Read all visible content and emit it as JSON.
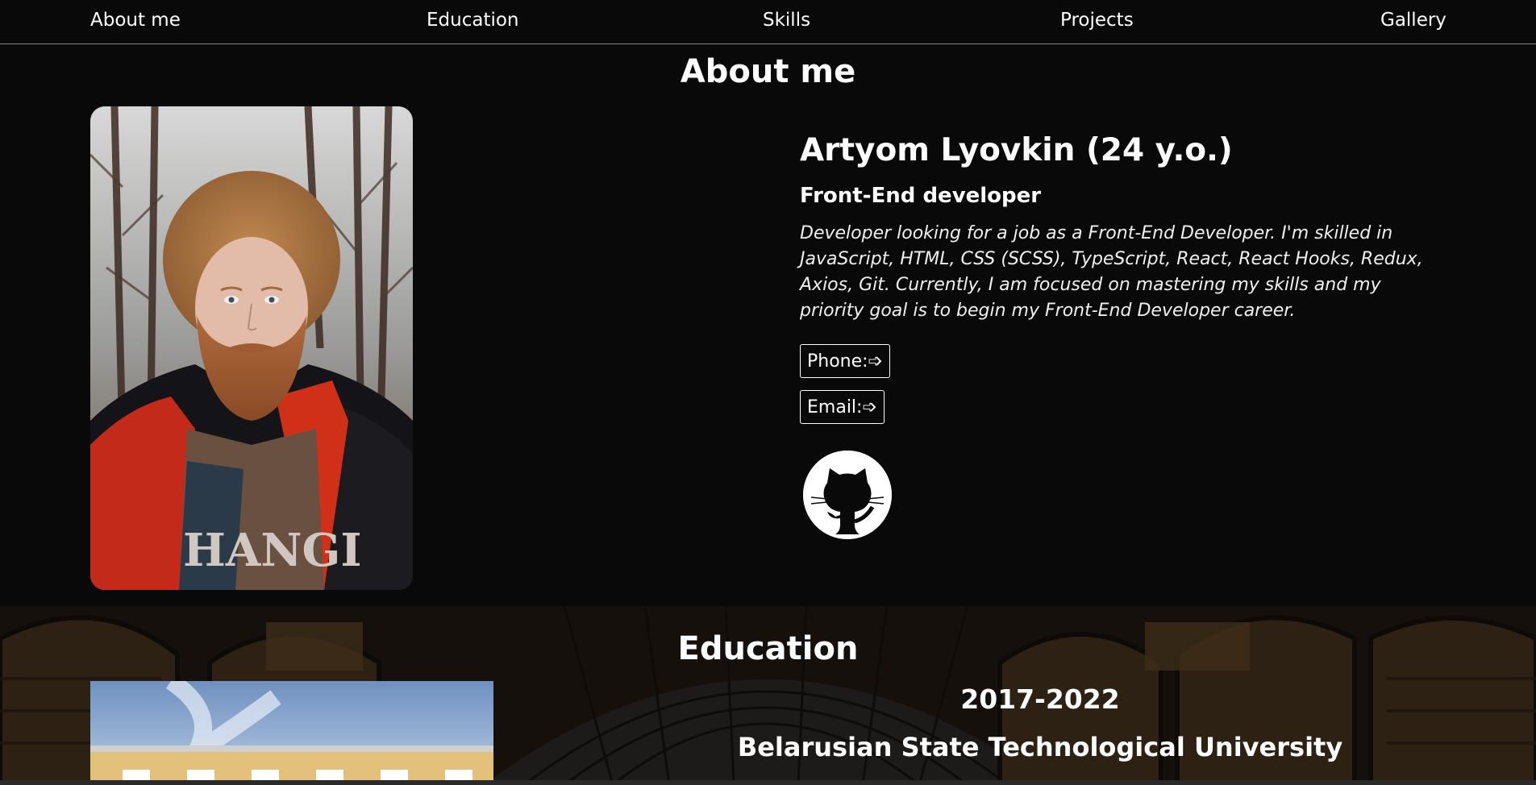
{
  "nav": {
    "items": [
      "About me",
      "Education",
      "Skills",
      "Projects",
      "Gallery"
    ]
  },
  "about": {
    "title": "About me",
    "name": "Artyom Lyovkin (24 y.o.)",
    "role": "Front-End developer",
    "bio": "Developer looking for a job as a Front-End Developer. I'm skilled in JavaScript, HTML, CSS (SCSS), TypeScript, React, React Hooks, Redux, Axios, Git. Currently, I am focused on mastering my skills and my priority goal is to begin my Front-End Developer career.",
    "phone_label": "Phone:➩",
    "email_label": "Email:➩",
    "github_icon": "github-icon"
  },
  "education": {
    "title": "Education",
    "years": "2017-2022",
    "university": "Belarusian State Technological University"
  },
  "colors": {
    "background": "#090909",
    "text": "#ffffff",
    "nav_border": "#8a8a8a"
  }
}
